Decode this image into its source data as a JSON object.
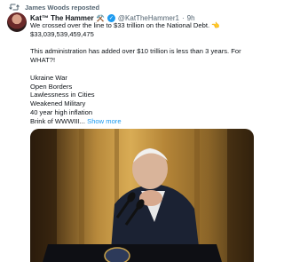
{
  "repost": {
    "label": "James Woods reposted"
  },
  "author": {
    "name": "Kat™ The Hammer",
    "name_emoji": "⚒️",
    "handle": "@KatTheHammer1",
    "separator": "·",
    "time": "9h"
  },
  "tweet": {
    "line1": "We crossed over the line to $33 trillion on the National Debt.",
    "line1_emoji": "👈",
    "line2": "$33,039,539,459,475",
    "line3": "This administration has added over $10 trillion is less than 3 years. For WHAT?!",
    "list": [
      "Ukraine War",
      "Open Borders",
      "Lawlessness in Cities",
      "Weakened Military",
      "40 year high inflation"
    ],
    "last_line": "Brink of WWWIII...",
    "show_more": "Show more"
  },
  "colors": {
    "link": "#1d9bf0",
    "secondary": "#536471",
    "text": "#0f1419"
  },
  "icons": {
    "repost": "repost-icon",
    "verified": "verified-badge-icon"
  }
}
